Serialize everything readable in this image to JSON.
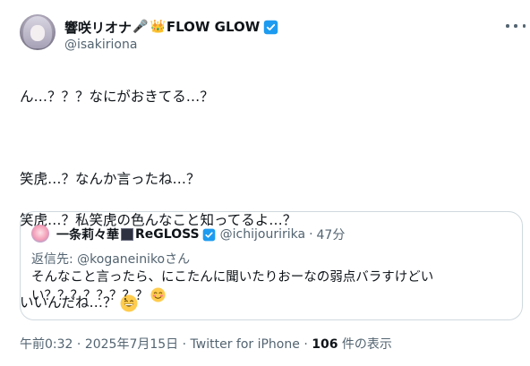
{
  "author": {
    "display_name": "響咲リオナ",
    "name_suffix": "FLOW GLOW",
    "name_emojis": [
      "🎤",
      "👑"
    ],
    "handle": "@isakiriona",
    "verified": true
  },
  "tweet": {
    "lines": [
      "ん…？？？なにがおきてる…？",
      "",
      "笑虎…？なんか言ったね…？",
      "笑虎…？私笑虎の色んなこと知ってるよ…？",
      "",
      "いいんだね…？"
    ],
    "trailing_emoji": "grinning-face"
  },
  "quote": {
    "display_name": "一条莉々華",
    "name_suffix": "ReGLOSS",
    "handle": "@ichijouririka",
    "separator": "·",
    "time": "47分",
    "reply_to_label": "返信先: ",
    "reply_to_handle": "@koganeinikoさん",
    "text": "そんなこと言ったら、にこたんに聞いたりおーなの弱点バラすけどいい？？？？？？？？",
    "trailing_emoji": "smiling-face-with-blush"
  },
  "footer": {
    "time": "午前0:32",
    "sep1": "·",
    "date": "2025年7月15日",
    "sep2": "·",
    "client": "Twitter for iPhone",
    "sep3": "·",
    "views_count": "106",
    "views_label": " 件の表示"
  },
  "colors": {
    "text_primary": "#0f1419",
    "text_secondary": "#536471",
    "verified_blue": "#1d9bf0",
    "border": "#cfd9de"
  }
}
